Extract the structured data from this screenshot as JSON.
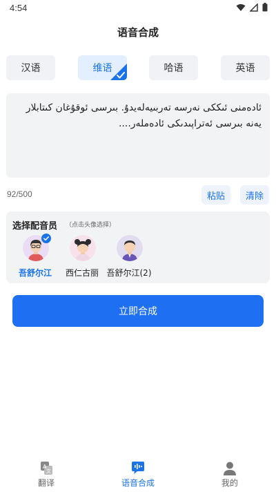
{
  "status_bar": {
    "time": "4:54"
  },
  "header": {
    "title": "语音合成"
  },
  "languages": [
    {
      "label": "汉语",
      "active": false
    },
    {
      "label": "维语",
      "active": true
    },
    {
      "label": "哈语",
      "active": false
    },
    {
      "label": "英语",
      "active": false
    }
  ],
  "editor": {
    "text": "ئادەمنى ئىككى نەرسە تەربىيەلەيدۇ. بىرسى ئوقۇغان كىتابلار يەنە بىرسى ئەتراپىدىكى ئادەملەر....",
    "counter": "92/500",
    "paste_label": "粘贴",
    "clear_label": "清除"
  },
  "voices": {
    "title": "选择配音员",
    "hint": "（点击头像选择）",
    "items": [
      {
        "name": "吾舒尔江",
        "selected": true
      },
      {
        "name": "西仁古丽",
        "selected": false
      },
      {
        "name": "吾舒尔江(2)",
        "selected": false
      }
    ]
  },
  "actions": {
    "synthesize_label": "立即合成"
  },
  "tab_bar": {
    "tabs": [
      {
        "label": "翻译",
        "active": false,
        "icon": "translate-icon"
      },
      {
        "label": "语音合成",
        "active": true,
        "icon": "voice-synthesis-icon"
      },
      {
        "label": "我的",
        "active": false,
        "icon": "profile-icon"
      }
    ]
  },
  "colors": {
    "accent": "#1f6ff2",
    "panel": "#f2f3f5",
    "active_tab": "#1a73e8"
  }
}
